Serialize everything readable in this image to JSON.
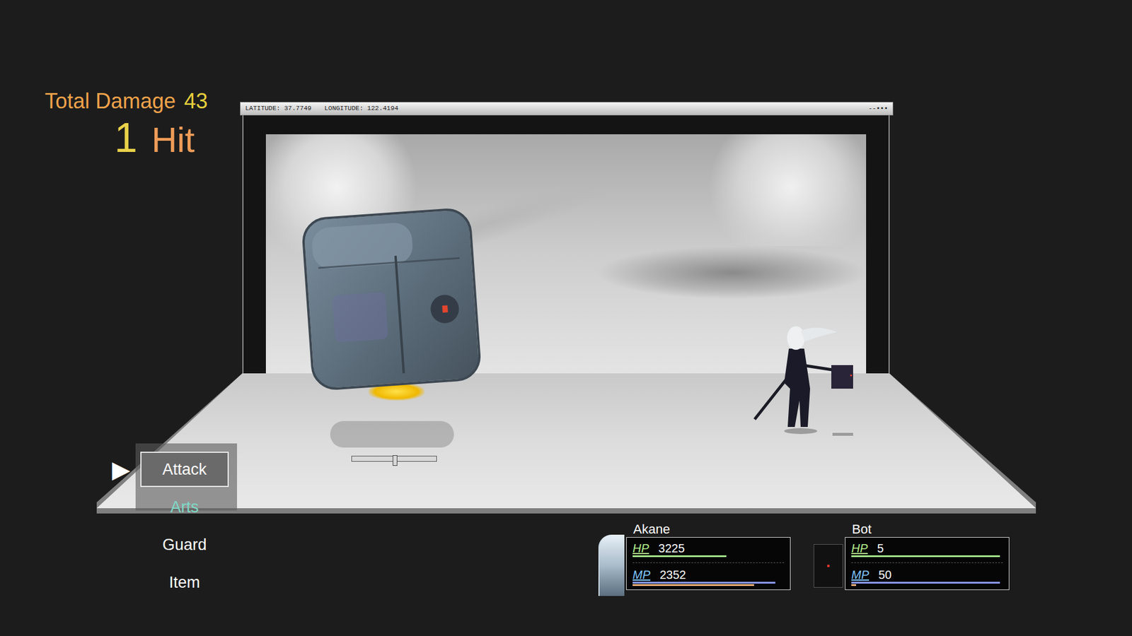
{
  "combo": {
    "total_label": "Total Damage",
    "total_damage": "43",
    "hits": "1",
    "hit_label": "Hit"
  },
  "stage": {
    "latitude": "LATITUDE: 37.7749",
    "longitude": "LONGITUDE: 122.4194",
    "window_controls": "--▪▪▪"
  },
  "enemy": {
    "gauge_level": 0.48
  },
  "command_menu": {
    "cursor": "▶",
    "items": [
      {
        "label": "Attack",
        "selected": true,
        "color": "#ffffff"
      },
      {
        "label": "Arts",
        "selected": false,
        "color": "#7fd9c6"
      },
      {
        "label": "Guard",
        "selected": false,
        "color": "#ffffff"
      },
      {
        "label": "Item",
        "selected": false,
        "color": "#ffffff"
      }
    ]
  },
  "party": [
    {
      "name": "Akane",
      "kind": "character",
      "hp_label": "HP",
      "hp": "3225",
      "hp_level": 0.62,
      "mp_label": "MP",
      "mp": "2352",
      "mp_level": 0.94,
      "tp_level": 0.8
    },
    {
      "name": "Bot",
      "kind": "machine",
      "hp_label": "HP",
      "hp": "5",
      "hp_level": 0.98,
      "mp_label": "MP",
      "mp": "50",
      "mp_level": 0.98,
      "tp_level": 0.03
    }
  ]
}
